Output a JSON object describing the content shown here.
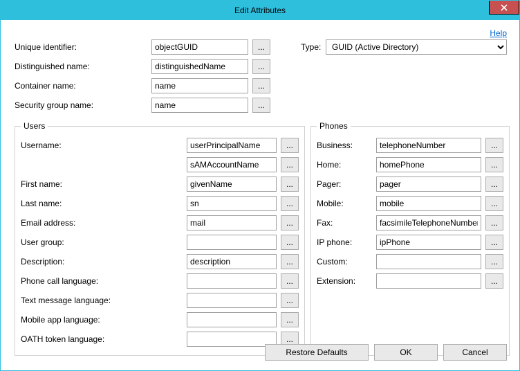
{
  "window": {
    "title": "Edit Attributes"
  },
  "help": {
    "label": "Help"
  },
  "top": {
    "uniqueId": {
      "label": "Unique identifier:",
      "value": "objectGUID"
    },
    "dn": {
      "label": "Distinguished name:",
      "value": "distinguishedName"
    },
    "container": {
      "label": "Container name:",
      "value": "name"
    },
    "secGroup": {
      "label": "Security group name:",
      "value": "name"
    },
    "type": {
      "label": "Type:",
      "value": "GUID (Active Directory)"
    },
    "browse": "..."
  },
  "users": {
    "legend": "Users",
    "rows": {
      "username": {
        "label": "Username:",
        "value": "userPrincipalName"
      },
      "username2": {
        "label": "",
        "value": "sAMAccountName"
      },
      "firstName": {
        "label": "First name:",
        "value": "givenName"
      },
      "lastName": {
        "label": "Last name:",
        "value": "sn"
      },
      "email": {
        "label": "Email address:",
        "value": "mail"
      },
      "userGroup": {
        "label": "User group:",
        "value": ""
      },
      "description": {
        "label": "Description:",
        "value": "description"
      },
      "phoneLang": {
        "label": "Phone call language:",
        "value": ""
      },
      "textLang": {
        "label": "Text message language:",
        "value": ""
      },
      "appLang": {
        "label": "Mobile app language:",
        "value": ""
      },
      "oathLang": {
        "label": "OATH token language:",
        "value": ""
      }
    }
  },
  "phones": {
    "legend": "Phones",
    "rows": {
      "business": {
        "label": "Business:",
        "value": "telephoneNumber"
      },
      "home": {
        "label": "Home:",
        "value": "homePhone"
      },
      "pager": {
        "label": "Pager:",
        "value": "pager"
      },
      "mobile": {
        "label": "Mobile:",
        "value": "mobile"
      },
      "fax": {
        "label": "Fax:",
        "value": "facsimileTelephoneNumber"
      },
      "ipPhone": {
        "label": "IP phone:",
        "value": "ipPhone"
      },
      "custom": {
        "label": "Custom:",
        "value": ""
      },
      "extension": {
        "label": "Extension:",
        "value": ""
      }
    }
  },
  "buttons": {
    "restore": "Restore Defaults",
    "ok": "OK",
    "cancel": "Cancel"
  }
}
